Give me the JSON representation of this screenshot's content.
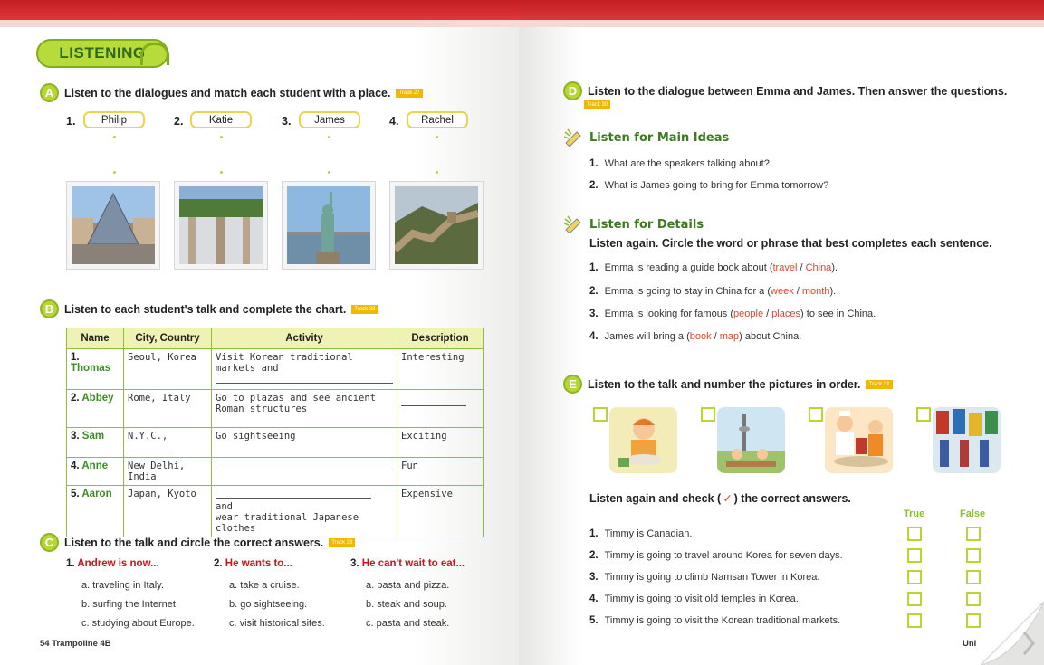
{
  "left": {
    "header": "LISTENING",
    "secA": {
      "letter": "A",
      "title": "Listen to the dialogues and match each student with a place.",
      "track": "Track 27",
      "students": [
        {
          "n": "1.",
          "name": "Philip"
        },
        {
          "n": "2.",
          "name": "Katie"
        },
        {
          "n": "3.",
          "name": "James"
        },
        {
          "n": "4.",
          "name": "Rachel"
        }
      ]
    },
    "secB": {
      "letter": "B",
      "title": "Listen to each student's talk and complete the chart.",
      "track": "Track 28",
      "headers": [
        "Name",
        "City, Country",
        "Activity",
        "Description"
      ],
      "rows": [
        {
          "num": "1.",
          "name": "Thomas",
          "city": "Seoul, Korea",
          "activity": "Visit Korean traditional markets and",
          "desc": "Interesting"
        },
        {
          "num": "2.",
          "name": "Abbey",
          "city": "Rome, Italy",
          "activity": "Go to plazas and see ancient Roman structures",
          "desc": ""
        },
        {
          "num": "3.",
          "name": "Sam",
          "city": "N.Y.C.,",
          "activity": "Go sightseeing",
          "desc": "Exciting"
        },
        {
          "num": "4.",
          "name": "Anne",
          "city": "New Delhi, India",
          "activity": "",
          "desc": "Fun"
        },
        {
          "num": "5.",
          "name": "Aaron",
          "city": "Japan, Kyoto",
          "activity_tail": "and",
          "activity2": "wear traditional Japanese clothes",
          "desc": "Expensive"
        }
      ]
    },
    "secC": {
      "letter": "C",
      "title": "Listen to the talk and circle the correct answers.",
      "track": "Track 29",
      "questions": [
        {
          "n": "1.",
          "q": "Andrew is now...",
          "opts": [
            "a. traveling in Italy.",
            "b. surfing the Internet.",
            "c. studying about Europe."
          ]
        },
        {
          "n": "2.",
          "q": "He wants to...",
          "opts": [
            "a. take a cruise.",
            "b. go sightseeing.",
            "c. visit historical sites."
          ]
        },
        {
          "n": "3.",
          "q": "He can't wait to eat...",
          "opts": [
            "a. pasta and pizza.",
            "b. steak and soup.",
            "c. pasta and steak."
          ]
        }
      ]
    },
    "footer": "54 Trampoline 4B"
  },
  "right": {
    "secD": {
      "letter": "D",
      "title": "Listen to the dialogue between Emma and James. Then answer the questions.",
      "track": "Track 30",
      "main_head": "Listen for Main Ideas",
      "main": [
        {
          "n": "1.",
          "t": "What are the speakers talking about?"
        },
        {
          "n": "2.",
          "t": "What is James going to bring for Emma tomorrow?"
        }
      ],
      "detail_head": "Listen for Details",
      "detail_instr": "Listen again. Circle the word or phrase that best completes each sentence.",
      "details": [
        {
          "n": "1.",
          "pre": "Emma is reading a guide book about (",
          "a": "travel",
          "b": "China",
          "post": ")."
        },
        {
          "n": "2.",
          "pre": "Emma is going to stay in China for a (",
          "a": "week",
          "b": "month",
          "post": ")."
        },
        {
          "n": "3.",
          "pre": "Emma is looking for famous (",
          "a": "people",
          "b": "places",
          "post": ") to see in China."
        },
        {
          "n": "4.",
          "pre": "James will bring a (",
          "a": "book",
          "b": "map",
          "post": ") about China."
        }
      ]
    },
    "secE": {
      "letter": "E",
      "title": "Listen to the talk and number the pictures in order.",
      "track": "Track 31",
      "check_pre": "Listen again and check (",
      "check_mark": "✓",
      "check_post": ") the correct answers.",
      "true_label": "True",
      "false_label": "False",
      "items": [
        {
          "n": "1.",
          "t": "Timmy is Canadian."
        },
        {
          "n": "2.",
          "t": "Timmy is going to travel around Korea for seven days."
        },
        {
          "n": "3.",
          "t": "Timmy is going to climb Namsan Tower in Korea."
        },
        {
          "n": "4.",
          "t": "Timmy is going to visit old temples in Korea."
        },
        {
          "n": "5.",
          "t": "Timmy is going to visit the Korean traditional markets."
        }
      ]
    },
    "footer": "Uni"
  }
}
